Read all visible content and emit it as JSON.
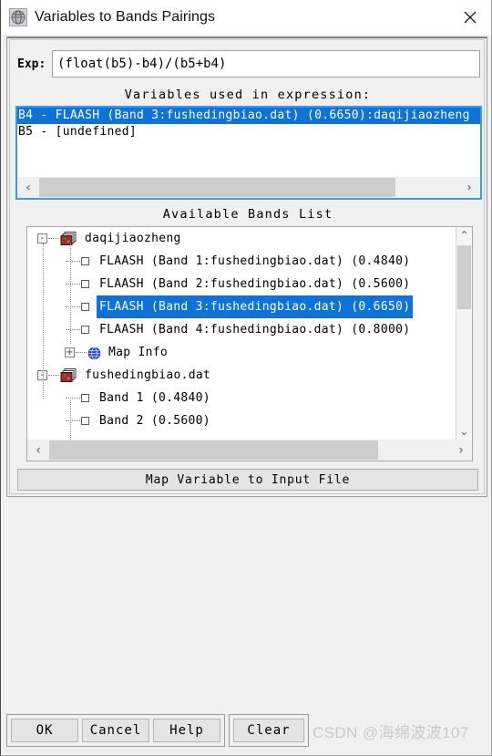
{
  "window": {
    "title": "Variables to Bands Pairings",
    "icon": "envi-globe-icon",
    "close_label": "×"
  },
  "expression": {
    "label": "Exp:",
    "value": "(float(b5)-b4)/(b5+b4)",
    "placeholder": ""
  },
  "variables_panel": {
    "title": "Variables used in expression:",
    "rows": [
      {
        "text": "B4 - FLAASH (Band 3:fushedingbiao.dat) (0.6650):daqijiaozheng",
        "selected": true
      },
      {
        "text": "B5 - [undefined]",
        "selected": false
      }
    ],
    "hscroll": {
      "left_arrow": "‹",
      "right_arrow": "›"
    }
  },
  "bands_panel": {
    "title": "Available Bands List",
    "tree": [
      {
        "level": 0,
        "toggle": "-",
        "icon": "image-stack-icon",
        "label": "daqijiaozheng",
        "selected": false,
        "checkbox": false
      },
      {
        "level": 1,
        "toggle": "",
        "icon": "checkbox-icon",
        "label": "FLAASH (Band 1:fushedingbiao.dat) (0.4840)",
        "selected": false,
        "checkbox": true
      },
      {
        "level": 1,
        "toggle": "",
        "icon": "checkbox-icon",
        "label": "FLAASH (Band 2:fushedingbiao.dat) (0.5600)",
        "selected": false,
        "checkbox": true
      },
      {
        "level": 1,
        "toggle": "",
        "icon": "checkbox-icon",
        "label": "FLAASH (Band 3:fushedingbiao.dat) (0.6650)",
        "selected": true,
        "checkbox": true
      },
      {
        "level": 1,
        "toggle": "",
        "icon": "checkbox-icon",
        "label": "FLAASH (Band 4:fushedingbiao.dat) (0.8000)",
        "selected": false,
        "checkbox": true
      },
      {
        "level": 1,
        "toggle": "+",
        "icon": "map-globe-icon",
        "label": "Map Info",
        "selected": false,
        "checkbox": false
      },
      {
        "level": 0,
        "toggle": "-",
        "icon": "image-stack-icon",
        "label": "fushedingbiao.dat",
        "selected": false,
        "checkbox": false
      },
      {
        "level": 1,
        "toggle": "",
        "icon": "checkbox-icon",
        "label": "Band 1 (0.4840)",
        "selected": false,
        "checkbox": true
      },
      {
        "level": 1,
        "toggle": "",
        "icon": "checkbox-icon",
        "label": "Band 2 (0.5600)",
        "selected": false,
        "checkbox": true
      }
    ],
    "vscroll": {
      "up_arrow": "⌃",
      "down_arrow": "⌄"
    },
    "hscroll": {
      "left_arrow": "‹",
      "right_arrow": "›"
    }
  },
  "map_variable_button": {
    "label": "Map Variable to Input File"
  },
  "buttons": {
    "primary_group": [
      {
        "label": "OK",
        "name": "ok-button"
      },
      {
        "label": "Cancel",
        "name": "cancel-button"
      },
      {
        "label": "Help",
        "name": "help-button"
      }
    ],
    "secondary_group": [
      {
        "label": "Clear",
        "name": "clear-button"
      }
    ]
  },
  "watermark": {
    "text": "CSDN @海绵波波107"
  },
  "colors": {
    "selection_blue": "#0f72d6",
    "focus_border": "#3a9ae8",
    "window_bg": "#f0f0f0",
    "field_bg": "#ffffff"
  }
}
